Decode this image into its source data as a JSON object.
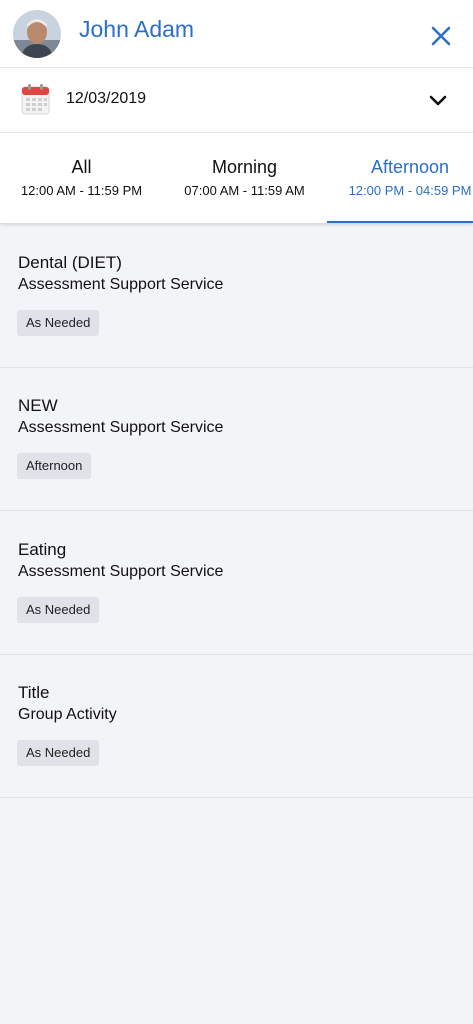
{
  "header": {
    "user_name": "John Adam",
    "avatar_icon": "user-photo",
    "close_icon": "close-icon"
  },
  "date_picker": {
    "value": "12/03/2019",
    "icon": "calendar-icon",
    "toggle_icon": "chevron-down-icon"
  },
  "tabs": [
    {
      "label": "All",
      "range": "12:00 AM - 11:59 PM",
      "active": false
    },
    {
      "label": "Morning",
      "range": "07:00 AM - 11:59 AM",
      "active": false
    },
    {
      "label": "Afternoon",
      "range": "12:00 PM - 04:59 PM",
      "active": true
    }
  ],
  "items": [
    {
      "title": "Dental (DIET)",
      "subtitle": "Assessment Support Service",
      "badge": "As Needed"
    },
    {
      "title": "NEW",
      "subtitle": "Assessment Support Service",
      "badge": "Afternoon"
    },
    {
      "title": "Eating",
      "subtitle": "Assessment Support Service",
      "badge": "As Needed"
    },
    {
      "title": "Title",
      "subtitle": "Group Activity",
      "badge": "As Needed"
    }
  ],
  "colors": {
    "accent": "#2a6fc9",
    "background": "#f2f4f8"
  }
}
